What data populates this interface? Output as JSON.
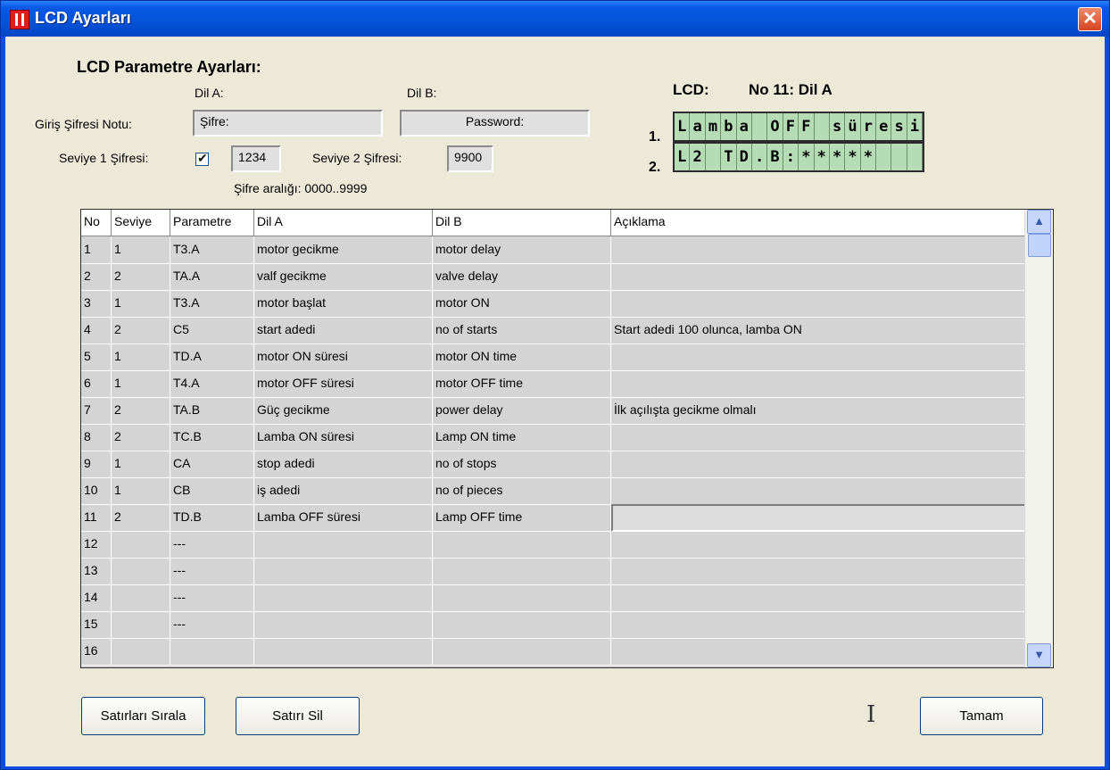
{
  "window": {
    "title": "LCD Ayarları",
    "close_label": "✕"
  },
  "section_title": "LCD Parametre Ayarları:",
  "lang_a_label": "Dil A:",
  "lang_b_label": "Dil B:",
  "password_note_label": "Giriş Şifresi Notu:",
  "password_note_a": "Şifre:",
  "password_note_b": "Password:",
  "level1_label": "Seviye 1 Şifresi:",
  "level1_enabled": true,
  "level1_value": "1234",
  "level2_label": "Seviye 2 Şifresi:",
  "level2_value": "9900",
  "password_range": "Şifre aralığı: 0000..9999",
  "lcd": {
    "label": "LCD:",
    "status": "No 11: Dil A",
    "line1_label": "1.",
    "line2_label": "2.",
    "line1": [
      "L",
      "a",
      "m",
      "b",
      "a",
      "",
      "O",
      "F",
      "F",
      "",
      "s",
      "ü",
      "r",
      "e",
      "s",
      "i"
    ],
    "line2": [
      "L",
      "2",
      "",
      "T",
      "D",
      ".",
      "B",
      ":",
      "*",
      "*",
      "*",
      "*",
      "*",
      "",
      "",
      ""
    ]
  },
  "table": {
    "headers": [
      "No",
      "Seviye",
      "Parametre",
      "Dil A",
      "Dil B",
      "Açıklama"
    ],
    "rows": [
      [
        "1",
        "1",
        "T3.A",
        "motor gecikme",
        "motor delay",
        ""
      ],
      [
        "2",
        "2",
        "TA.A",
        "valf gecikme",
        "valve delay",
        ""
      ],
      [
        "3",
        "1",
        "T3.A",
        "motor başlat",
        "motor ON",
        ""
      ],
      [
        "4",
        "2",
        "C5",
        "start adedi",
        "no of starts",
        "Start adedi 100 olunca, lamba ON"
      ],
      [
        "5",
        "1",
        "TD.A",
        "motor ON süresi",
        "motor ON time",
        ""
      ],
      [
        "6",
        "1",
        "T4.A",
        "motor OFF süresi",
        "motor OFF time",
        ""
      ],
      [
        "7",
        "2",
        "TA.B",
        "Güç gecikme",
        "power delay",
        "İlk açılışta gecikme olmalı"
      ],
      [
        "8",
        "2",
        "TC.B",
        "Lamba ON süresi",
        "Lamp ON time",
        ""
      ],
      [
        "9",
        "1",
        "CA",
        "stop adedi",
        "no of stops",
        ""
      ],
      [
        "10",
        "1",
        "CB",
        "iş adedi",
        "no of pieces",
        ""
      ],
      [
        "11",
        "2",
        "TD.B",
        "Lamba OFF süresi",
        "Lamp OFF time",
        ""
      ],
      [
        "12",
        "",
        "---",
        "",
        "",
        ""
      ],
      [
        "13",
        "",
        "---",
        "",
        "",
        ""
      ],
      [
        "14",
        "",
        "---",
        "",
        "",
        ""
      ],
      [
        "15",
        "",
        "---",
        "",
        "",
        ""
      ],
      [
        "16",
        "",
        "",
        "",
        "",
        ""
      ]
    ]
  },
  "buttons": {
    "sort": "Satırları Sırala",
    "delete": "Satırı Sil",
    "ok": "Tamam"
  }
}
